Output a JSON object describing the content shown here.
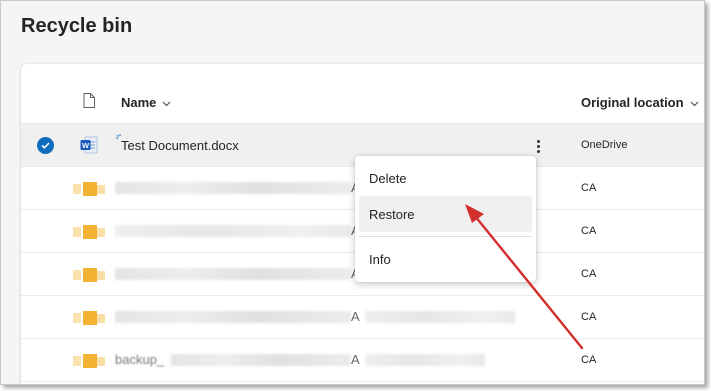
{
  "page": {
    "title": "Recycle bin"
  },
  "table": {
    "columns": {
      "name": "Name",
      "location": "Original location"
    },
    "rows": [
      {
        "name": "Test Document.docx",
        "location": "OneDrive",
        "type": "word",
        "selected": true
      },
      {
        "name_tail": "A",
        "location": "CA",
        "type": "folder"
      },
      {
        "name_tail": "A",
        "location": "CA",
        "type": "folder"
      },
      {
        "name_tail": "A",
        "location": "CA",
        "type": "folder"
      },
      {
        "name_tail": "A",
        "location": "CA",
        "type": "folder"
      },
      {
        "name": "backup_",
        "name_tail": "A",
        "location": "CA",
        "type": "folder"
      }
    ]
  },
  "context_menu": {
    "items": [
      "Delete",
      "Restore",
      "Info"
    ],
    "highlighted": "Restore"
  },
  "annotation": {
    "arrow_color": "#d32f2f"
  },
  "colors": {
    "accent": "#0f6cbd",
    "word_blue": "#185abd",
    "folder_yellow": "#f2b233"
  }
}
